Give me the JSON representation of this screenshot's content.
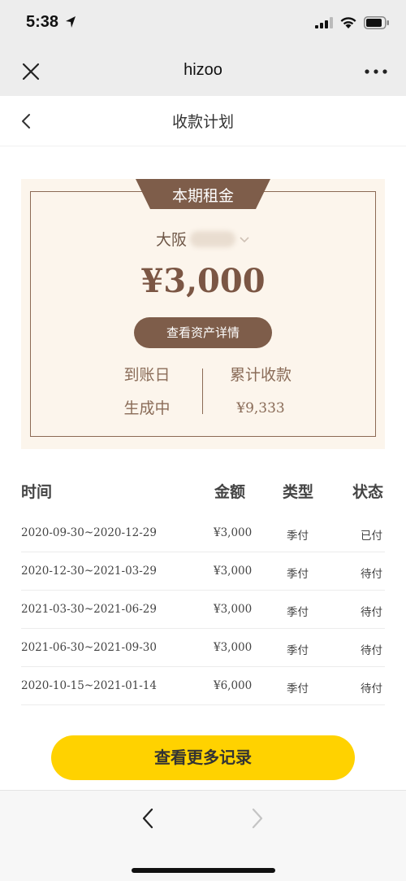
{
  "status_bar": {
    "time": "5:38"
  },
  "wx_header": {
    "title": "hizoo"
  },
  "page_header": {
    "title": "收款计划"
  },
  "rent_card": {
    "tab_label": "本期租金",
    "asset_name": "大阪",
    "amount": "¥3,000",
    "detail_button": "查看资产详情",
    "arrival_label": "到账日",
    "arrival_value": "生成中",
    "cumulative_label": "累计收款",
    "cumulative_value": "¥9,333"
  },
  "table": {
    "headers": {
      "time": "时间",
      "amount": "金额",
      "type": "类型",
      "status": "状态"
    },
    "rows": [
      {
        "time": "2020-09-30~2020-12-29",
        "amount": "¥3,000",
        "type": "季付",
        "status": "已付"
      },
      {
        "time": "2020-12-30~2021-03-29",
        "amount": "¥3,000",
        "type": "季付",
        "status": "待付"
      },
      {
        "time": "2021-03-30~2021-06-29",
        "amount": "¥3,000",
        "type": "季付",
        "status": "待付"
      },
      {
        "time": "2021-06-30~2021-09-30",
        "amount": "¥3,000",
        "type": "季付",
        "status": "待付"
      },
      {
        "time": "2020-10-15~2021-01-14",
        "amount": "¥6,000",
        "type": "季付",
        "status": "待付"
      }
    ]
  },
  "more_button": "查看更多记录",
  "colors": {
    "brown": "#7e5d4a",
    "card_bg": "#fcf5ec",
    "yellow": "#ffd200"
  }
}
